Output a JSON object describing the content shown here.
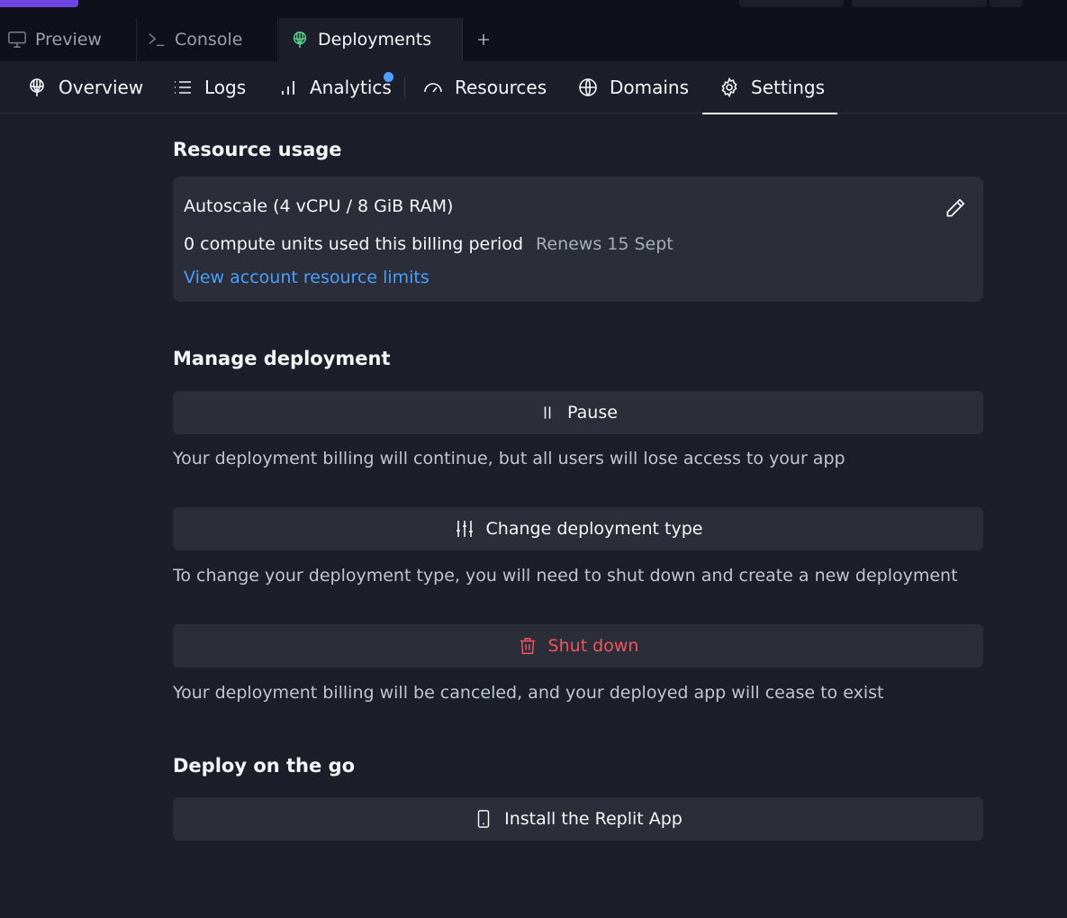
{
  "top_tabs": [
    {
      "label": "Preview",
      "icon": "monitor-icon",
      "active": false
    },
    {
      "label": "Console",
      "icon": "terminal-icon",
      "active": false
    },
    {
      "label": "Deployments",
      "icon": "deployments-icon",
      "active": true
    }
  ],
  "subnav": [
    {
      "label": "Overview",
      "icon": "deploy-rocket-icon"
    },
    {
      "label": "Logs",
      "icon": "list-icon"
    },
    {
      "label": "Analytics",
      "icon": "bar-chart-icon",
      "notification": true
    },
    {
      "label": "Resources",
      "icon": "gauge-icon"
    },
    {
      "label": "Domains",
      "icon": "globe-icon"
    },
    {
      "label": "Settings",
      "icon": "gear-icon",
      "active": true
    }
  ],
  "resource_usage": {
    "title": "Resource usage",
    "plan": "Autoscale (4 vCPU / 8 GiB RAM)",
    "usage": "0 compute units used this billing period",
    "renews": "Renews 15 Sept",
    "limits_link": "View account resource limits"
  },
  "manage": {
    "title": "Manage deployment",
    "pause_label": "Pause",
    "pause_desc": "Your deployment billing will continue, but all users will lose access to your app",
    "change_label": "Change deployment type",
    "change_desc": "To change your deployment type, you will need to shut down and create a new deployment",
    "shutdown_label": "Shut down",
    "shutdown_desc": "Your deployment billing will be canceled, and your deployed app will cease to exist"
  },
  "go": {
    "title": "Deploy on the go",
    "install_label": "Install the Replit App"
  },
  "colors": {
    "background": "#1c1f29",
    "card": "#2b2e39",
    "link": "#4a9eff",
    "danger": "#f0555f",
    "notification": "#4da3ff"
  }
}
